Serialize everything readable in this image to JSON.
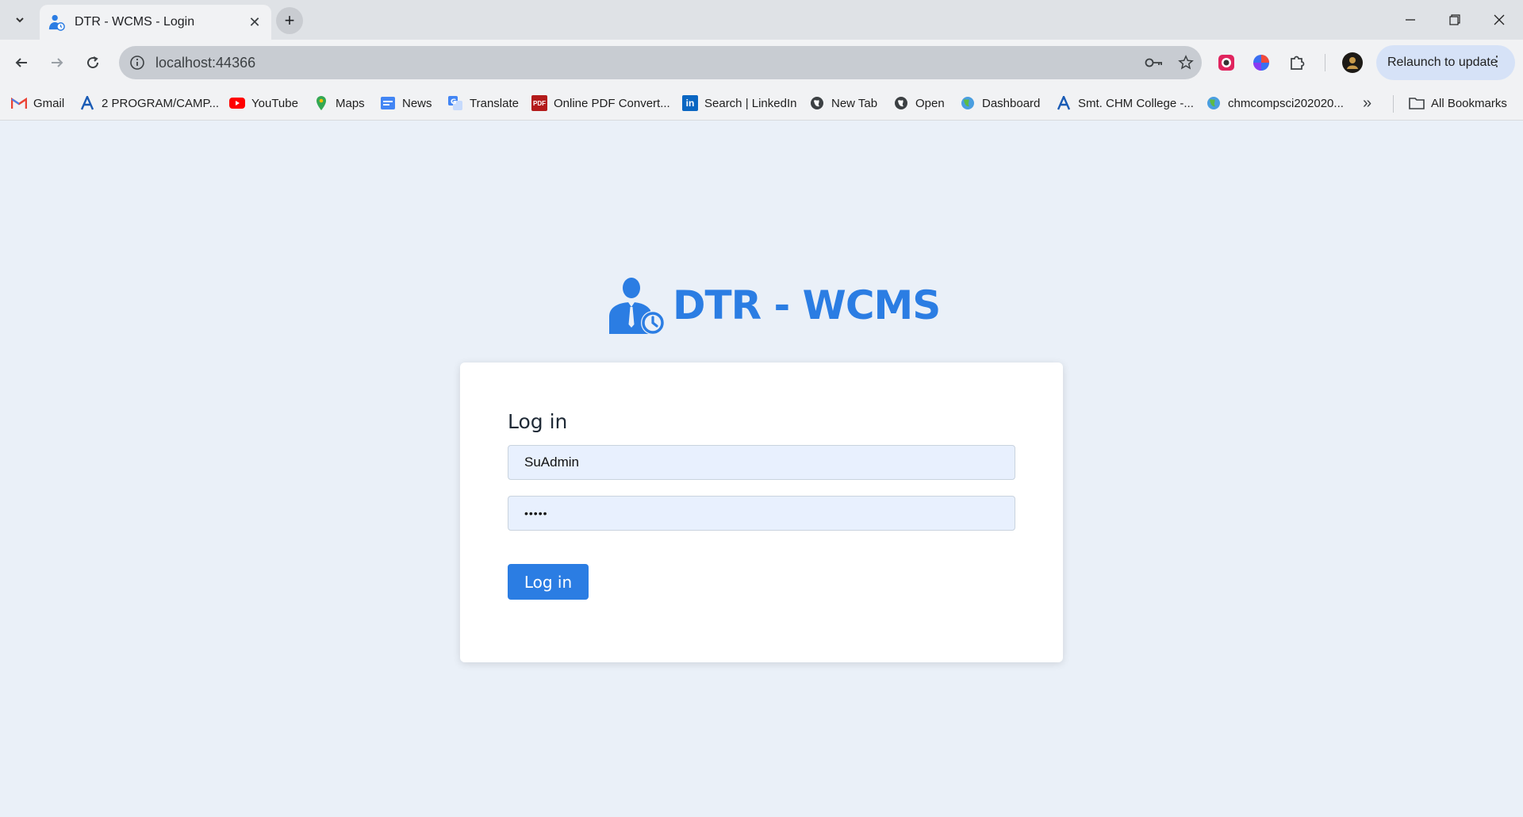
{
  "browser": {
    "tab_title": "DTR - WCMS - Login",
    "url": "localhost:44366",
    "relaunch_label": "Relaunch to update",
    "bookmarks": [
      {
        "label": "Gmail",
        "icon": "gmail-icon"
      },
      {
        "label": "2 PROGRAM/CAMP...",
        "icon": "a-logo-icon"
      },
      {
        "label": "YouTube",
        "icon": "youtube-icon"
      },
      {
        "label": "Maps",
        "icon": "maps-icon"
      },
      {
        "label": "News",
        "icon": "news-icon"
      },
      {
        "label": "Translate",
        "icon": "translate-icon"
      },
      {
        "label": "Online PDF Convert...",
        "icon": "pdf-icon"
      },
      {
        "label": "Search | LinkedIn",
        "icon": "linkedin-icon"
      },
      {
        "label": "New Tab",
        "icon": "globe-icon"
      },
      {
        "label": "Open",
        "icon": "globe-icon"
      },
      {
        "label": "Dashboard",
        "icon": "earth-icon"
      },
      {
        "label": "Smt. CHM College -...",
        "icon": "a-logo-icon"
      },
      {
        "label": "chmcompsci202020...",
        "icon": "earth-icon"
      }
    ],
    "all_bookmarks_label": "All Bookmarks"
  },
  "page": {
    "brand_title": "DTR - WCMS",
    "login_heading": "Log in",
    "username_value": "SuAdmin",
    "password_value": "•••••",
    "login_button_label": "Log in"
  },
  "colors": {
    "accent": "#2b7de3",
    "page_background": "#eaf0f8",
    "input_background": "#e8f0fe"
  }
}
